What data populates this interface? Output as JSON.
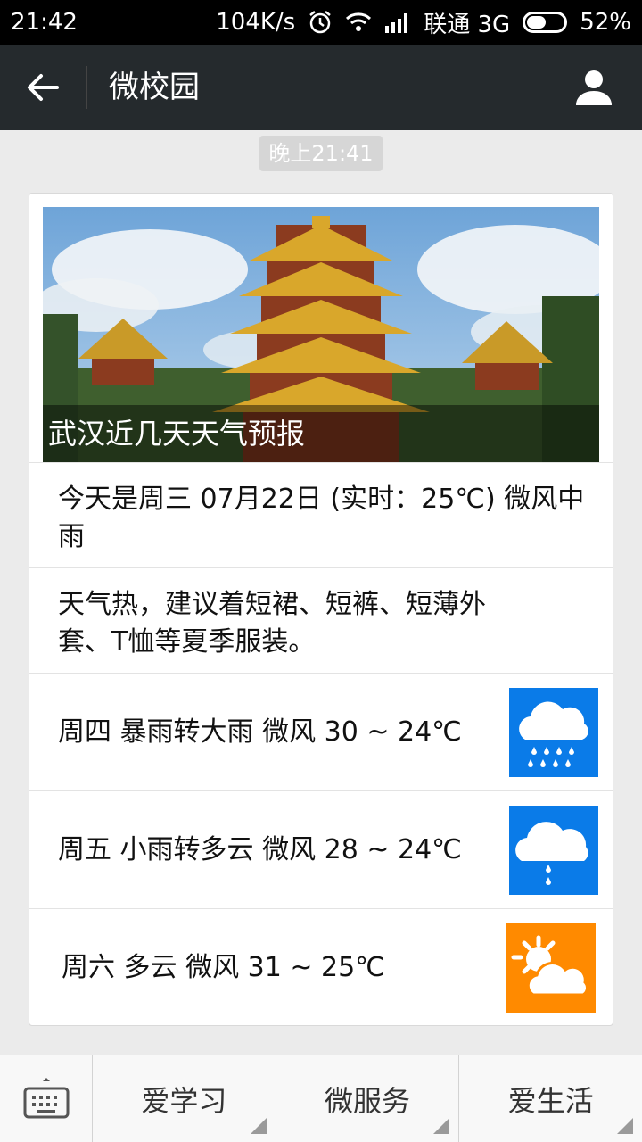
{
  "status_bar": {
    "time": "21:42",
    "speed": "104K/s",
    "carrier": "联通 3G",
    "battery": "52%",
    "battery_level": 0.52
  },
  "title_bar": {
    "title": "微校园"
  },
  "timestamp": "晚上21:41",
  "article": {
    "hero_caption": "武汉近几天天气预报",
    "today": "今天是周三 07月22日 (实时：25℃) 微风中雨",
    "advice": "天气热，建议着短裙、短裤、短薄外套、T恤等夏季服装。",
    "forecast": [
      {
        "text": "周四 暴雨转大雨 微风 30 ~ 24℃",
        "icon": "heavy-rain-icon",
        "color": "#0a7be8"
      },
      {
        "text": "周五 小雨转多云 微风 28 ~ 24℃",
        "icon": "light-rain-icon",
        "color": "#0a7be8"
      },
      {
        "text": "周六 多云 微风 31 ~ 25℃",
        "icon": "partly-cloudy-icon",
        "color": "#ff8a00"
      }
    ]
  },
  "bottom_menu": {
    "keyboard_icon": "keyboard-icon",
    "items": [
      "爱学习",
      "微服务",
      "爱生活"
    ]
  }
}
